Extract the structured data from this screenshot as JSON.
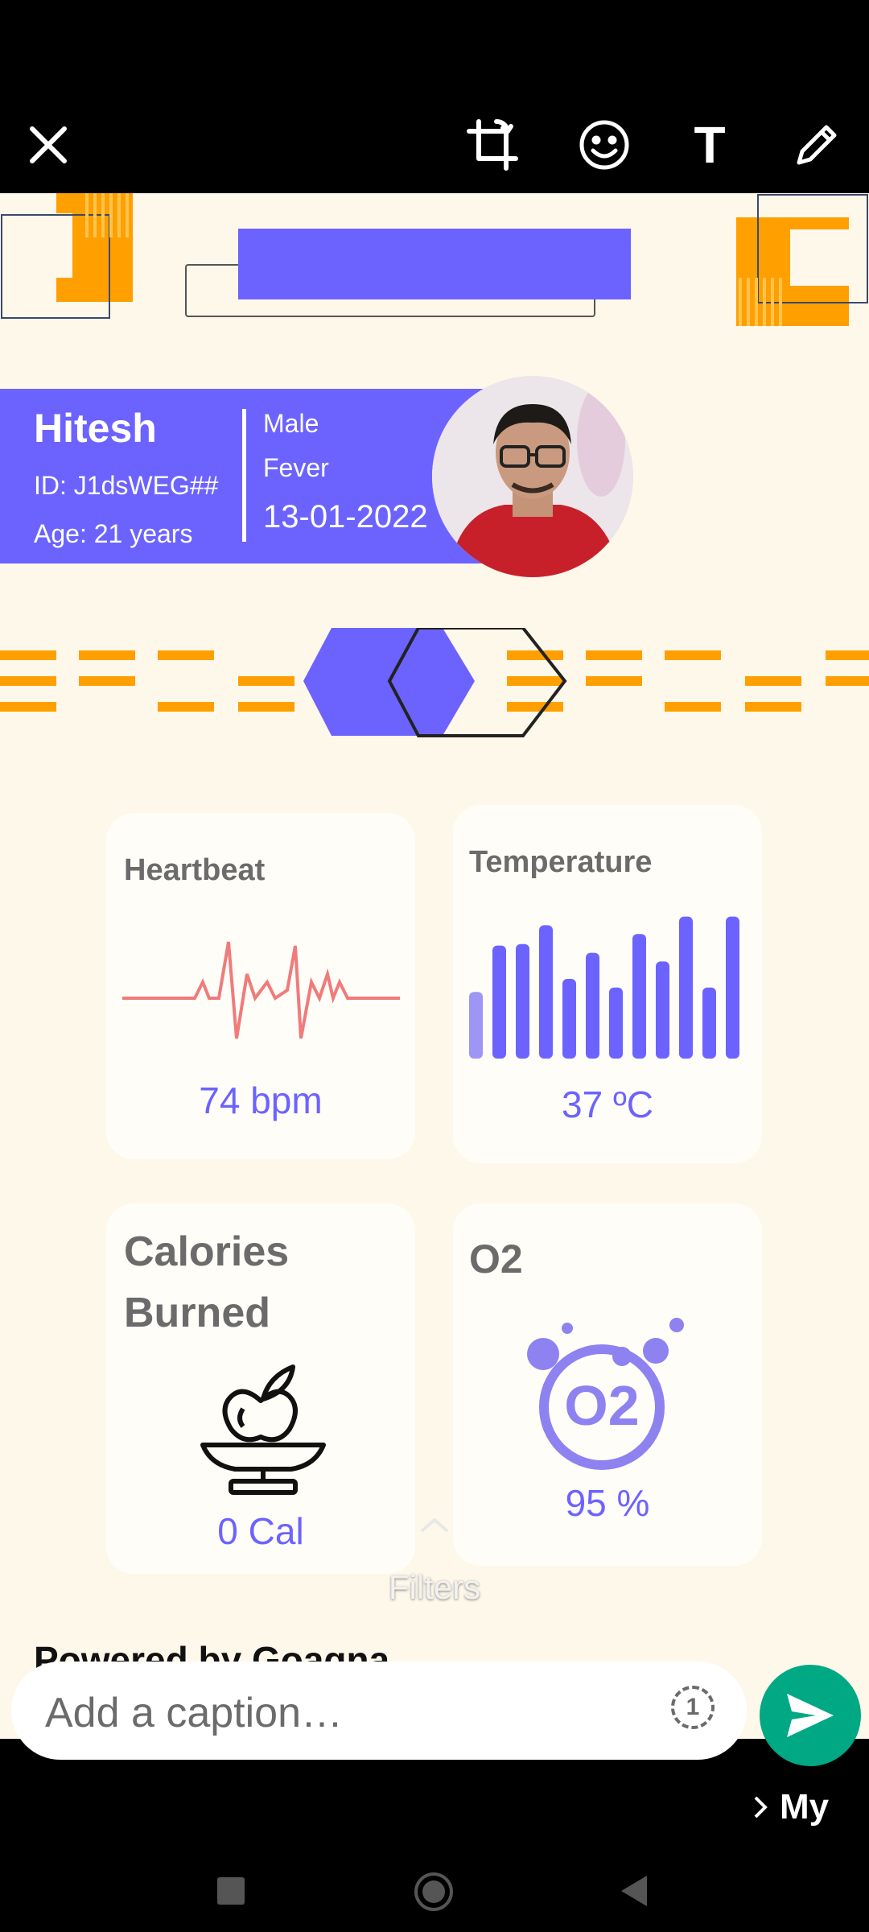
{
  "editor": {
    "close": "close-icon",
    "crop": "crop-rotate-icon",
    "emoji": "emoji-icon",
    "text": "T",
    "draw": "pencil-icon"
  },
  "patient": {
    "name": "Hitesh",
    "id": "ID: J1dsWEG##",
    "age": "Age: 21 years",
    "gender": "Male",
    "condition": "Fever",
    "date": "13-01-2022"
  },
  "cards": {
    "heartbeat": {
      "title": "Heartbeat",
      "value": "74 bpm"
    },
    "temperature": {
      "title": "Temperature",
      "value": "37 ºC",
      "bars": [
        0.46,
        0.78,
        0.79,
        0.92,
        0.55,
        0.73,
        0.49,
        0.86,
        0.67,
        0.98,
        0.49,
        0.98
      ]
    },
    "calories": {
      "title_line1": "Calories",
      "title_line2": "Burned",
      "value": "0 Cal"
    },
    "o2": {
      "title": "O2",
      "value": "95 %",
      "badge": "O2"
    }
  },
  "footer_text": "Powered by Goaqna",
  "filters_label": "Filters",
  "caption": {
    "placeholder": "Add a caption…",
    "timer_badge": "1"
  },
  "recipient": "My",
  "colors": {
    "accent": "#6c63ff",
    "orange": "#ff9f00",
    "cream": "#fdf8ea",
    "send": "#00a884",
    "heart": "#f07b7b"
  }
}
